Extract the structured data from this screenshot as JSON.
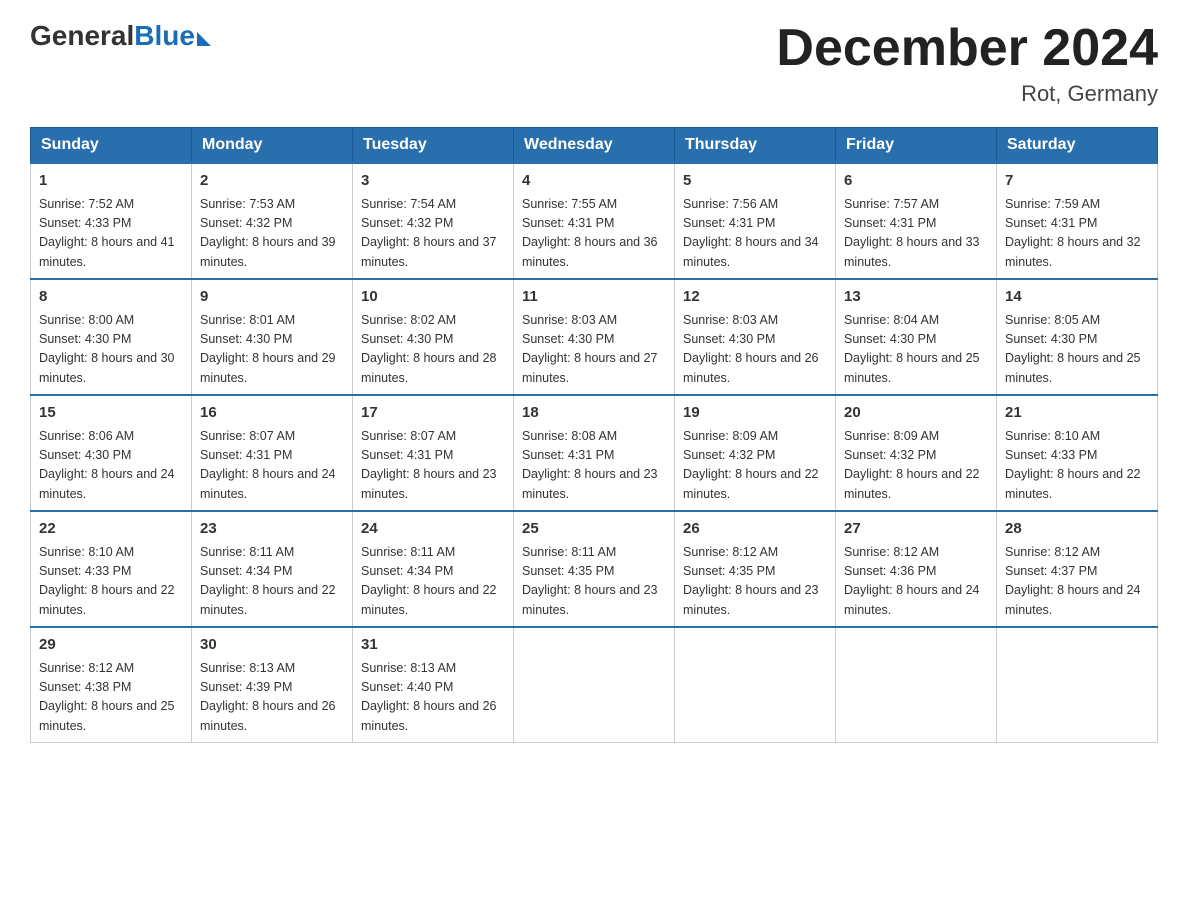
{
  "logo": {
    "general": "General",
    "blue": "Blue"
  },
  "title": "December 2024",
  "subtitle": "Rot, Germany",
  "headers": [
    "Sunday",
    "Monday",
    "Tuesday",
    "Wednesday",
    "Thursday",
    "Friday",
    "Saturday"
  ],
  "weeks": [
    [
      {
        "day": "1",
        "sunrise": "7:52 AM",
        "sunset": "4:33 PM",
        "daylight": "8 hours and 41 minutes."
      },
      {
        "day": "2",
        "sunrise": "7:53 AM",
        "sunset": "4:32 PM",
        "daylight": "8 hours and 39 minutes."
      },
      {
        "day": "3",
        "sunrise": "7:54 AM",
        "sunset": "4:32 PM",
        "daylight": "8 hours and 37 minutes."
      },
      {
        "day": "4",
        "sunrise": "7:55 AM",
        "sunset": "4:31 PM",
        "daylight": "8 hours and 36 minutes."
      },
      {
        "day": "5",
        "sunrise": "7:56 AM",
        "sunset": "4:31 PM",
        "daylight": "8 hours and 34 minutes."
      },
      {
        "day": "6",
        "sunrise": "7:57 AM",
        "sunset": "4:31 PM",
        "daylight": "8 hours and 33 minutes."
      },
      {
        "day": "7",
        "sunrise": "7:59 AM",
        "sunset": "4:31 PM",
        "daylight": "8 hours and 32 minutes."
      }
    ],
    [
      {
        "day": "8",
        "sunrise": "8:00 AM",
        "sunset": "4:30 PM",
        "daylight": "8 hours and 30 minutes."
      },
      {
        "day": "9",
        "sunrise": "8:01 AM",
        "sunset": "4:30 PM",
        "daylight": "8 hours and 29 minutes."
      },
      {
        "day": "10",
        "sunrise": "8:02 AM",
        "sunset": "4:30 PM",
        "daylight": "8 hours and 28 minutes."
      },
      {
        "day": "11",
        "sunrise": "8:03 AM",
        "sunset": "4:30 PM",
        "daylight": "8 hours and 27 minutes."
      },
      {
        "day": "12",
        "sunrise": "8:03 AM",
        "sunset": "4:30 PM",
        "daylight": "8 hours and 26 minutes."
      },
      {
        "day": "13",
        "sunrise": "8:04 AM",
        "sunset": "4:30 PM",
        "daylight": "8 hours and 25 minutes."
      },
      {
        "day": "14",
        "sunrise": "8:05 AM",
        "sunset": "4:30 PM",
        "daylight": "8 hours and 25 minutes."
      }
    ],
    [
      {
        "day": "15",
        "sunrise": "8:06 AM",
        "sunset": "4:30 PM",
        "daylight": "8 hours and 24 minutes."
      },
      {
        "day": "16",
        "sunrise": "8:07 AM",
        "sunset": "4:31 PM",
        "daylight": "8 hours and 24 minutes."
      },
      {
        "day": "17",
        "sunrise": "8:07 AM",
        "sunset": "4:31 PM",
        "daylight": "8 hours and 23 minutes."
      },
      {
        "day": "18",
        "sunrise": "8:08 AM",
        "sunset": "4:31 PM",
        "daylight": "8 hours and 23 minutes."
      },
      {
        "day": "19",
        "sunrise": "8:09 AM",
        "sunset": "4:32 PM",
        "daylight": "8 hours and 22 minutes."
      },
      {
        "day": "20",
        "sunrise": "8:09 AM",
        "sunset": "4:32 PM",
        "daylight": "8 hours and 22 minutes."
      },
      {
        "day": "21",
        "sunrise": "8:10 AM",
        "sunset": "4:33 PM",
        "daylight": "8 hours and 22 minutes."
      }
    ],
    [
      {
        "day": "22",
        "sunrise": "8:10 AM",
        "sunset": "4:33 PM",
        "daylight": "8 hours and 22 minutes."
      },
      {
        "day": "23",
        "sunrise": "8:11 AM",
        "sunset": "4:34 PM",
        "daylight": "8 hours and 22 minutes."
      },
      {
        "day": "24",
        "sunrise": "8:11 AM",
        "sunset": "4:34 PM",
        "daylight": "8 hours and 22 minutes."
      },
      {
        "day": "25",
        "sunrise": "8:11 AM",
        "sunset": "4:35 PM",
        "daylight": "8 hours and 23 minutes."
      },
      {
        "day": "26",
        "sunrise": "8:12 AM",
        "sunset": "4:35 PM",
        "daylight": "8 hours and 23 minutes."
      },
      {
        "day": "27",
        "sunrise": "8:12 AM",
        "sunset": "4:36 PM",
        "daylight": "8 hours and 24 minutes."
      },
      {
        "day": "28",
        "sunrise": "8:12 AM",
        "sunset": "4:37 PM",
        "daylight": "8 hours and 24 minutes."
      }
    ],
    [
      {
        "day": "29",
        "sunrise": "8:12 AM",
        "sunset": "4:38 PM",
        "daylight": "8 hours and 25 minutes."
      },
      {
        "day": "30",
        "sunrise": "8:13 AM",
        "sunset": "4:39 PM",
        "daylight": "8 hours and 26 minutes."
      },
      {
        "day": "31",
        "sunrise": "8:13 AM",
        "sunset": "4:40 PM",
        "daylight": "8 hours and 26 minutes."
      },
      null,
      null,
      null,
      null
    ]
  ]
}
